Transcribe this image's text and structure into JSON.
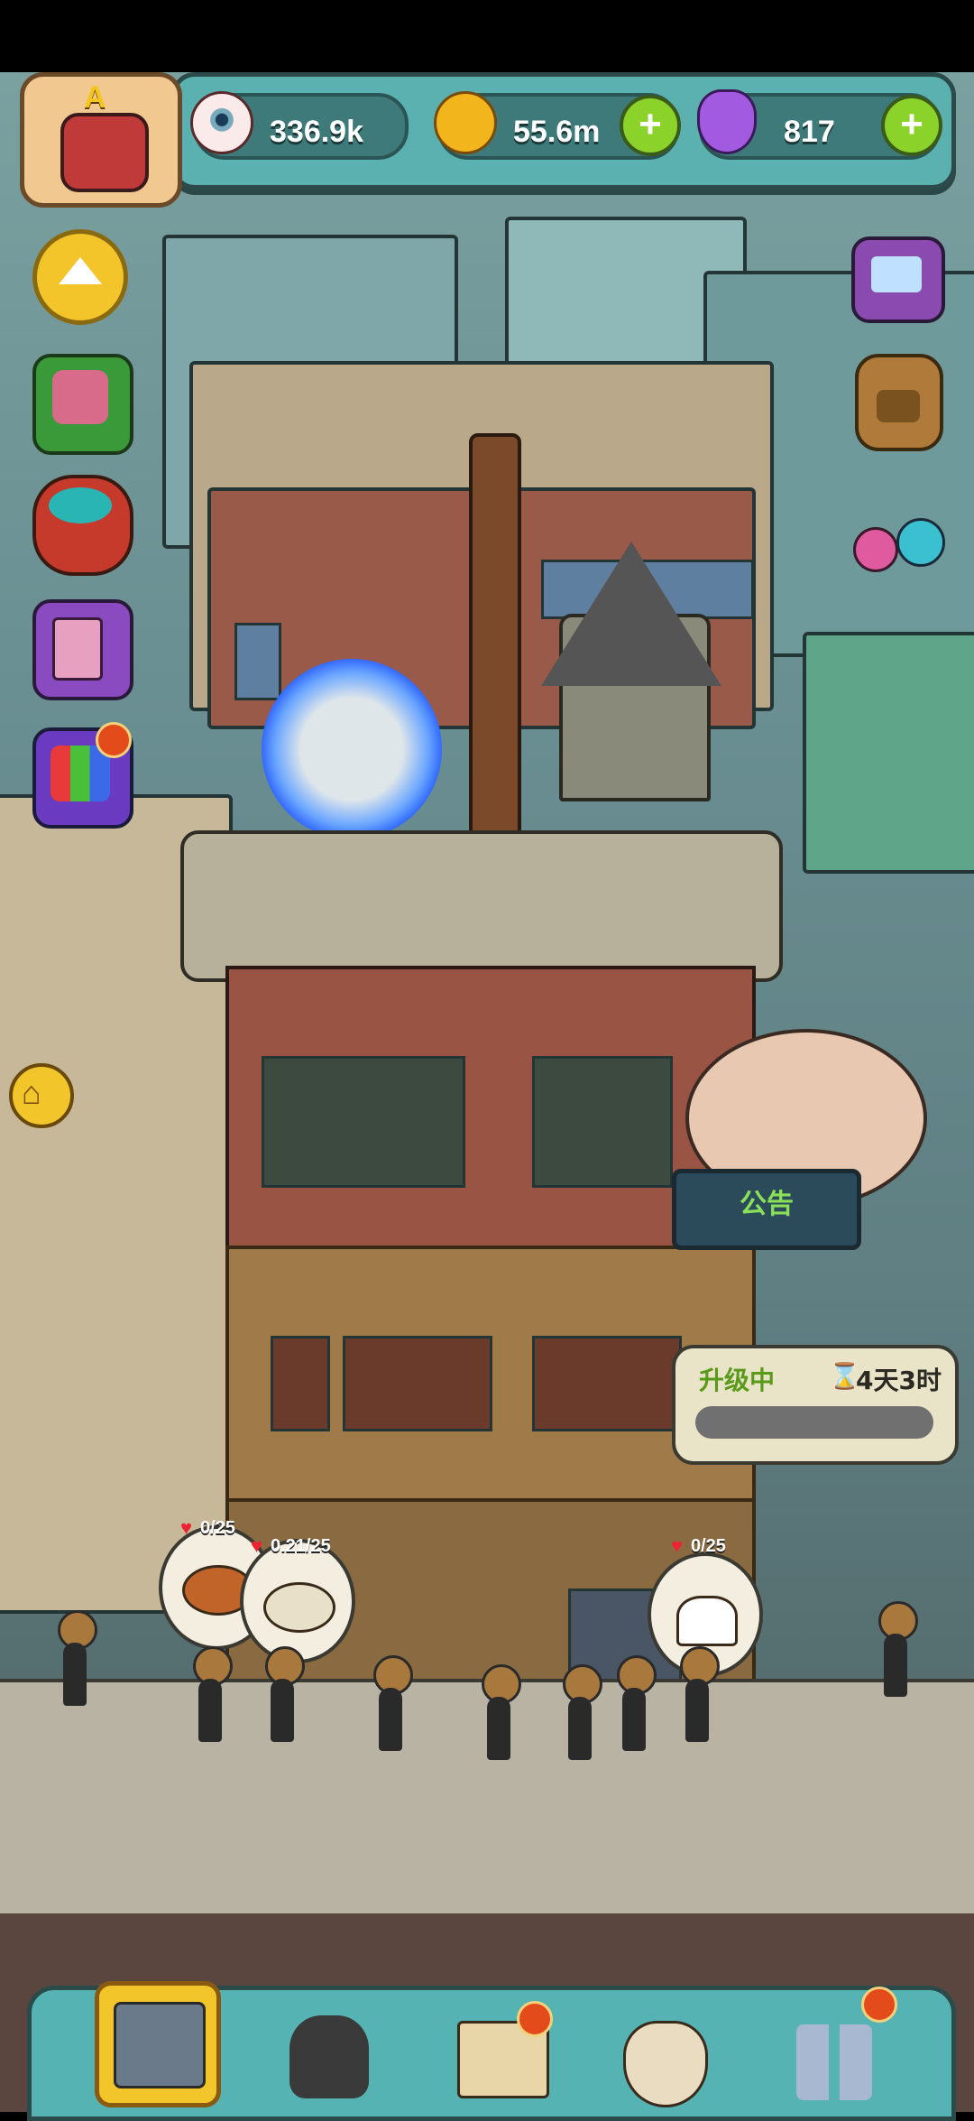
{
  "status_bar": {},
  "resources": {
    "eyes": {
      "icon": "eyeball-icon",
      "value": "336.9k"
    },
    "coins": {
      "icon": "coin-icon",
      "value": "55.6m"
    },
    "potions": {
      "icon": "potion-icon",
      "value": "817"
    }
  },
  "player": {
    "rank_letter": "A",
    "avatar_icon": "player-avatar-icon"
  },
  "left_menu": [
    {
      "icon": "up-arrow-icon"
    },
    {
      "icon": "gift-box-icon"
    },
    {
      "icon": "fruit-basket-icon"
    },
    {
      "icon": "cards-icon"
    },
    {
      "icon": "present-icon",
      "has_badge": true
    }
  ],
  "right_menu": [
    {
      "icon": "tv-video-icon"
    },
    {
      "icon": "backpack-icon"
    },
    {
      "icon": "monster-eyes-icon"
    }
  ],
  "home_button": {
    "icon": "home-icon"
  },
  "notice_sign": {
    "label": "公告"
  },
  "upgrade_bubble": {
    "status": "升级中",
    "timer": "4天3时",
    "timer_icon": "hourglass-icon"
  },
  "customer_requests": [
    {
      "label": "0/25",
      "icon": "pizza-icon"
    },
    {
      "label": "0.21/25",
      "icon": "eggs-plate-icon"
    },
    {
      "label": "0/25",
      "icon": "rice-ball-icon"
    }
  ],
  "bottom_nav": [
    {
      "icon": "kitchen-stove-icon",
      "selected": true
    },
    {
      "icon": "monster-chef-icon"
    },
    {
      "icon": "recipe-book-icon",
      "has_badge": true
    },
    {
      "icon": "money-bag-icon"
    },
    {
      "icon": "grid-menu-icon",
      "has_badge": true
    }
  ],
  "colors": {
    "accent_green": "#8bd22b",
    "panel_teal": "#5bb0b0",
    "badge_red": "#e44b1a"
  }
}
